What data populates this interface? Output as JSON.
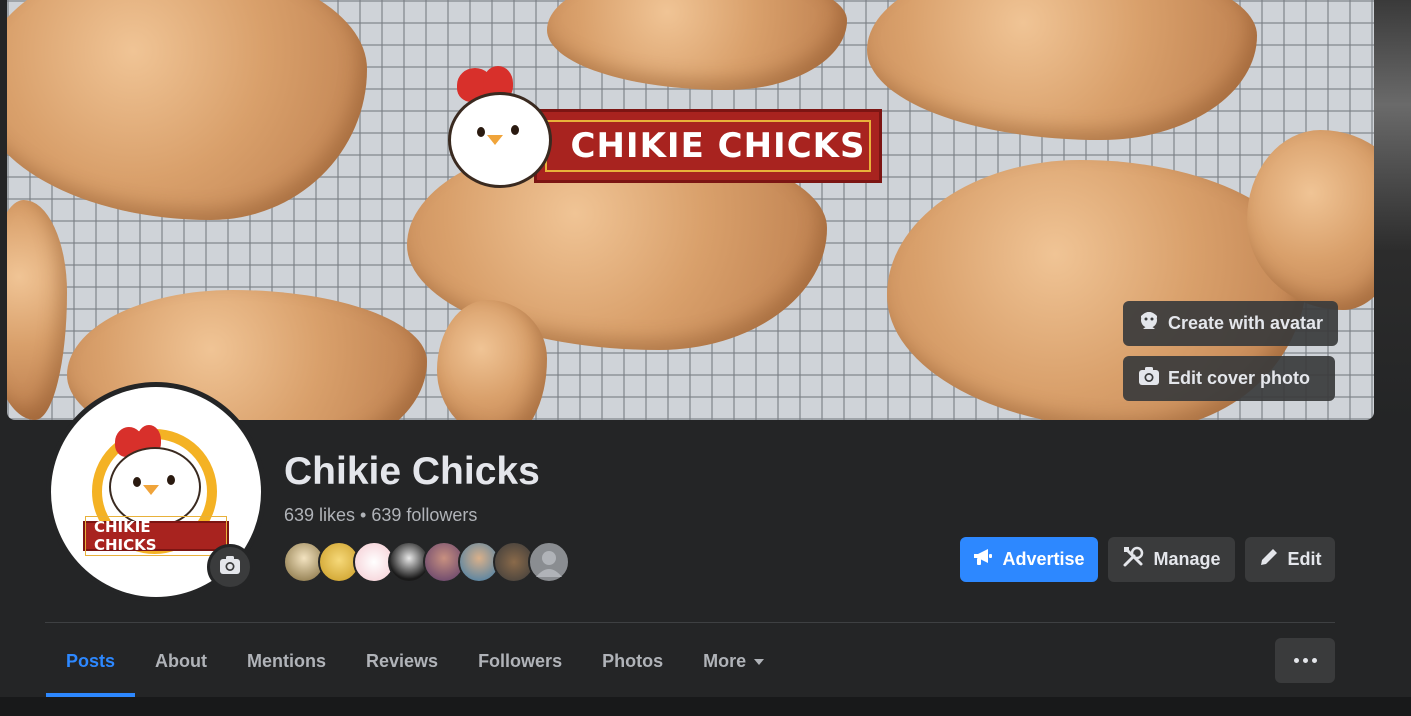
{
  "cover": {
    "logo_text": "CHIKIE CHICKS",
    "create_avatar_label": "Create with avatar",
    "edit_cover_label": "Edit cover photo"
  },
  "profile": {
    "avatar_logo_text": "CHIKIE CHICKS",
    "name": "Chikie Chicks",
    "stats": "639 likes • 639 followers"
  },
  "actions": {
    "advertise_label": "Advertise",
    "manage_label": "Manage",
    "edit_label": "Edit"
  },
  "tabs": [
    {
      "label": "Posts",
      "active": true
    },
    {
      "label": "About"
    },
    {
      "label": "Mentions"
    },
    {
      "label": "Reviews"
    },
    {
      "label": "Followers"
    },
    {
      "label": "Photos"
    },
    {
      "label": "More"
    }
  ],
  "colors": {
    "accent": "#2d88ff",
    "surface": "#242526",
    "button_secondary": "#3a3b3c",
    "brand_red": "#a8231f",
    "brand_yellow": "#f4b224"
  },
  "icons": {
    "avatar_button": "avatar-face-icon",
    "cover_button": "camera-icon",
    "advertise": "megaphone-icon",
    "manage": "tools-icon",
    "edit": "pencil-icon",
    "more": "caret-down-icon",
    "options": "ellipsis-icon"
  }
}
